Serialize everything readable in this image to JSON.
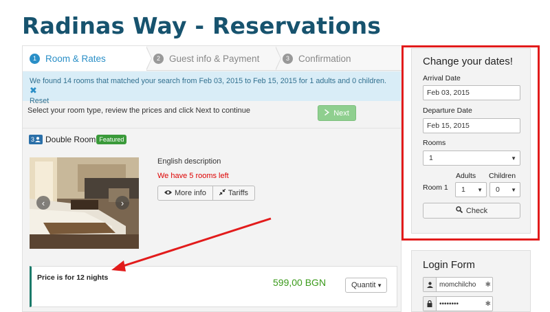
{
  "page": {
    "title": "Radinas Way - Reservations"
  },
  "steps": [
    {
      "num": "1",
      "label": "Room & Rates"
    },
    {
      "num": "2",
      "label": "Guest info & Payment"
    },
    {
      "num": "3",
      "label": "Confirmation"
    }
  ],
  "alert": {
    "text": "We found 14 rooms that matched your search from Feb 03, 2015 to Feb 15, 2015 for 1 adults and 0 children.",
    "close_icon": "✖",
    "reset_label": "Reset"
  },
  "instructions": "Select your room type, review the prices and click Next to continue",
  "next_button": {
    "label": "Next",
    "icon": "chevron-right-icon"
  },
  "room": {
    "count": "3",
    "name": "Double Room",
    "badge": "Featured",
    "description": "English description",
    "availability": "We have 5 rooms left",
    "more_info_label": "More info",
    "tariffs_label": "Tariffs",
    "price_note": "Price is for 12 nights",
    "price": "599,00 BGN",
    "quantity_label": "Quantit"
  },
  "change_dates": {
    "title": "Change your dates!",
    "arrival_label": "Arrival Date",
    "arrival_value": "Feb 03, 2015",
    "departure_label": "Departure Date",
    "departure_value": "Feb 15, 2015",
    "rooms_label": "Rooms",
    "rooms_value": "1",
    "adults_label": "Adults",
    "children_label": "Children",
    "room_row_label": "Room 1",
    "adults_value": "1",
    "children_value": "0",
    "check_label": "Check"
  },
  "login": {
    "title": "Login Form",
    "username": "momchilcho",
    "password": "••••••••"
  },
  "colors": {
    "title": "#17536e",
    "accent": "#2a8fc7",
    "alert_bg": "#d9edf7",
    "highlight_border": "#e21b1b",
    "price": "#3a9a1a",
    "warning_text": "#dd0000"
  }
}
